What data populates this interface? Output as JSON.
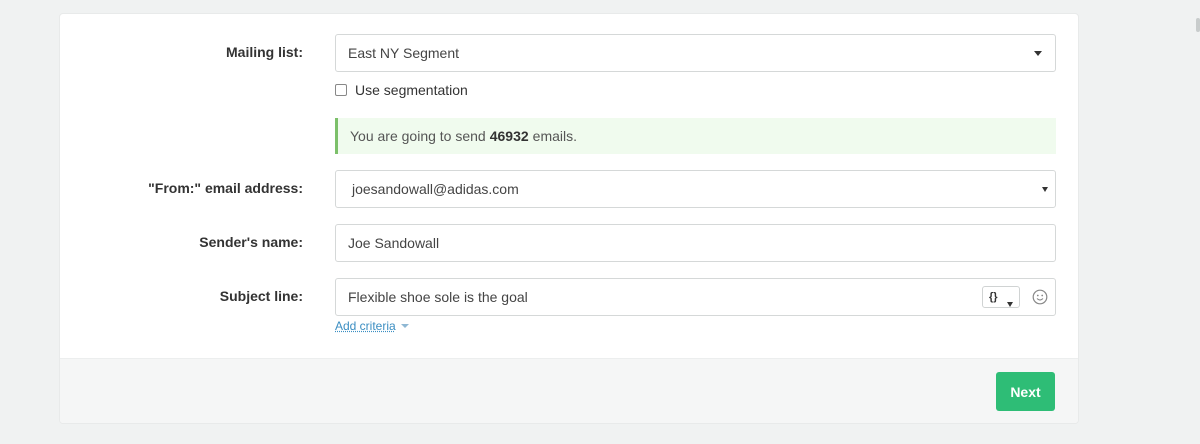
{
  "form": {
    "mailing_list": {
      "label": "Mailing list:",
      "value": "East NY Segment"
    },
    "segmentation": {
      "label": "Use segmentation",
      "checked": false
    },
    "alert": {
      "prefix": "You are going to send",
      "count": "46932",
      "suffix": "emails."
    },
    "from_email": {
      "label": "\"From:\" email address:",
      "value": "joesandowall@adidas.com"
    },
    "sender_name": {
      "label": "Sender's name:",
      "value": "Joe Sandowall"
    },
    "subject": {
      "label": "Subject line:",
      "value": "Flexible shoe sole is the goal",
      "var_button": "{}",
      "emoji_icon": "smiley-icon"
    },
    "add_criteria": "Add criteria"
  },
  "footer": {
    "next_label": "Next",
    "next_color": "#2ebd76"
  },
  "colors": {
    "alert_bg": "#f0fbee",
    "alert_border": "#7cc06a",
    "link": "#3b8ec2"
  }
}
